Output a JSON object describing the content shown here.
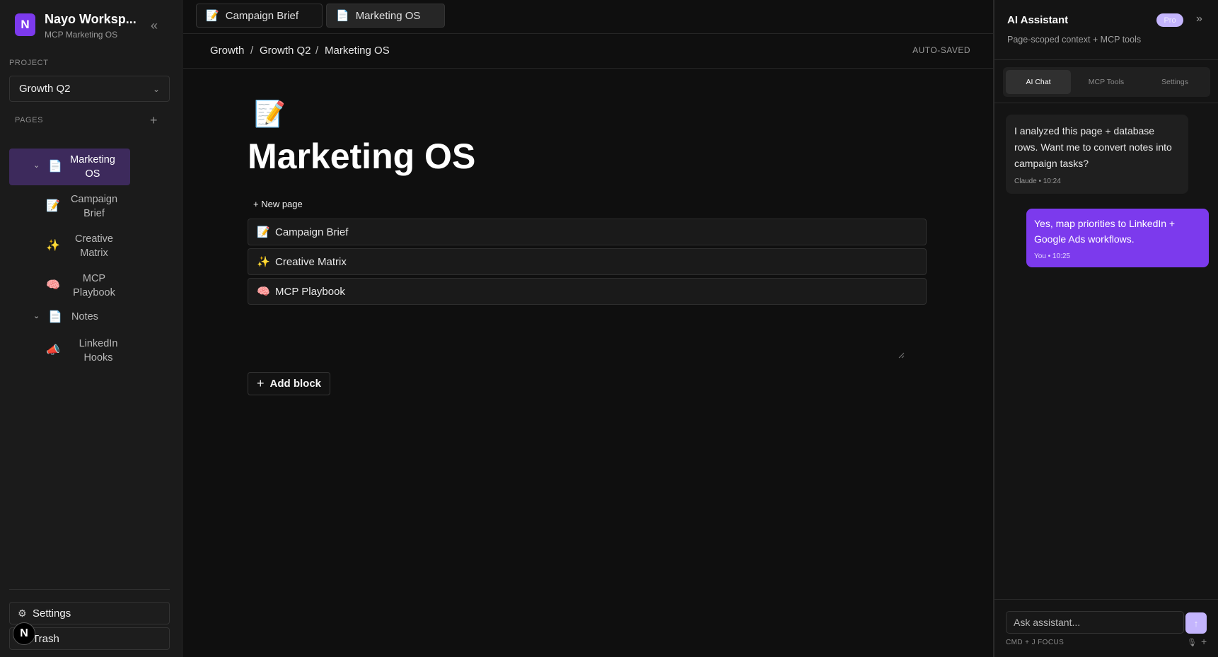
{
  "workspace": {
    "logo": "N",
    "name": "Nayo Worksp...",
    "subtitle": "MCP Marketing OS",
    "collapse_icon": "«"
  },
  "project": {
    "label": "PROJECT",
    "selected": "Growth Q2",
    "chevron": "⌄"
  },
  "pages": {
    "label": "PAGES",
    "add_icon": "+",
    "items": [
      {
        "label_line1": "Marketing",
        "label_line2": "OS",
        "icon": "📄",
        "caret": "⌄",
        "active": true
      },
      {
        "label_line1": "Campaign",
        "label_line2": "Brief",
        "icon": "📝"
      },
      {
        "label_line1": "Creative",
        "label_line2": "Matrix",
        "icon": "✨"
      },
      {
        "label_line1": "MCP",
        "label_line2": "Playbook",
        "icon": "🧠"
      },
      {
        "label_line1": "Notes",
        "icon": "📄",
        "caret": "⌄"
      },
      {
        "label_line1": "LinkedIn",
        "label_line2": "Hooks",
        "icon": "📣"
      }
    ]
  },
  "sidebar_footer": {
    "settings_label": "Settings",
    "settings_icon": "⚙",
    "trash_label": "Trash",
    "badge": "N"
  },
  "tabs": [
    {
      "label": "Campaign Brief",
      "icon": "📝"
    },
    {
      "label": "Marketing OS",
      "icon": "📄",
      "active": true
    }
  ],
  "breadcrumb": [
    "Growth",
    "Growth Q2",
    "Marketing OS"
  ],
  "breadcrumb_sep": "/",
  "status": "AUTO-SAVED",
  "page": {
    "emoji": "📝",
    "title": "Marketing OS",
    "new_page_label": "+ New page",
    "subpages": [
      {
        "label": "Campaign Brief",
        "icon": "📝"
      },
      {
        "label": "Creative Matrix",
        "icon": "✨"
      },
      {
        "label": "MCP Playbook",
        "icon": "🧠"
      }
    ],
    "add_block_label": "Add block",
    "add_block_icon": "+"
  },
  "assistant": {
    "title": "AI Assistant",
    "badge": "Pro",
    "expand_icon": "»",
    "subtitle": "Page-scoped context + MCP tools",
    "tabs": [
      "AI Chat",
      "MCP Tools",
      "Settings"
    ],
    "messages": [
      {
        "role": "ai",
        "text": "I analyzed this page + database rows. Want me to convert notes into campaign tasks?",
        "meta": "Claude • 10:24"
      },
      {
        "role": "user",
        "text": "Yes, map priorities to LinkedIn + Google Ads workflows.",
        "meta": "You • 10:25"
      }
    ],
    "input_placeholder": "Ask assistant...",
    "send_icon": "↑",
    "hint": "CMD + J FOCUS",
    "mic_icon": "🎙",
    "plus_icon": "+"
  },
  "colors": {
    "accent": "#7c3aed",
    "active_nav": "#3d2a5c",
    "badge_light": "#c4b5fd"
  }
}
